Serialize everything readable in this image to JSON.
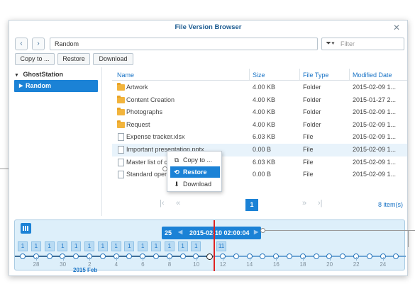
{
  "window": {
    "title": "File Version Browser",
    "close_icon": "close-icon"
  },
  "nav": {
    "back_glyph": "‹",
    "forward_glyph": "›"
  },
  "path": {
    "value": "Random"
  },
  "filter": {
    "placeholder": "Filter",
    "icon": "filter-icon"
  },
  "toolbar": {
    "copy_label": "Copy to ...",
    "restore_label": "Restore",
    "download_label": "Download"
  },
  "tree": {
    "root": "GhostStation",
    "selected": "Random"
  },
  "columns": {
    "name": "Name",
    "size": "Size",
    "type": "File Type",
    "modified": "Modified Date"
  },
  "rows": [
    {
      "name": "Artwork",
      "size": "4.00 KB",
      "type": "Folder",
      "modified": "2015-02-09 1...",
      "kind": "folder"
    },
    {
      "name": "Content Creation",
      "size": "4.00 KB",
      "type": "Folder",
      "modified": "2015-01-27 2...",
      "kind": "folder"
    },
    {
      "name": "Photographs",
      "size": "4.00 KB",
      "type": "Folder",
      "modified": "2015-02-09 1...",
      "kind": "folder"
    },
    {
      "name": "Request",
      "size": "4.00 KB",
      "type": "Folder",
      "modified": "2015-02-09 1...",
      "kind": "folder"
    },
    {
      "name": "Expense tracker.xlsx",
      "size": "6.03 KB",
      "type": "File",
      "modified": "2015-02-09 1...",
      "kind": "file"
    },
    {
      "name": "Important presentation.pptx",
      "size": "0.00 B",
      "type": "File",
      "modified": "2015-02-09 1...",
      "kind": "file"
    },
    {
      "name": "Master list of co",
      "size": "6.03 KB",
      "type": "File",
      "modified": "2015-02-09 1...",
      "kind": "file"
    },
    {
      "name": "Standard operat",
      "size": "0.00 B",
      "type": "File",
      "modified": "2015-02-09 1...",
      "kind": "file"
    }
  ],
  "pager": {
    "first": "|‹",
    "prev": "«",
    "page": "1",
    "next": "»",
    "last": "›|",
    "count": "8 item(s)"
  },
  "context_menu": {
    "copy": "Copy to ...",
    "restore": "Restore",
    "download": "Download"
  },
  "timeline": {
    "version_count": "25",
    "current": "2015-02-10 02:00:04",
    "left_arrow": "◀",
    "right_arrow": "▶",
    "version_boxes": [
      "1",
      "1",
      "1",
      "1",
      "1",
      "1",
      "1",
      "1",
      "1",
      "1",
      "1",
      "1",
      "1",
      "1",
      "11"
    ],
    "tick_labels": [
      "28",
      "30",
      "2",
      "4",
      "6",
      "8",
      "10",
      "12",
      "14",
      "16",
      "18",
      "20",
      "22",
      "24"
    ],
    "month_label": "2015 Feb"
  }
}
